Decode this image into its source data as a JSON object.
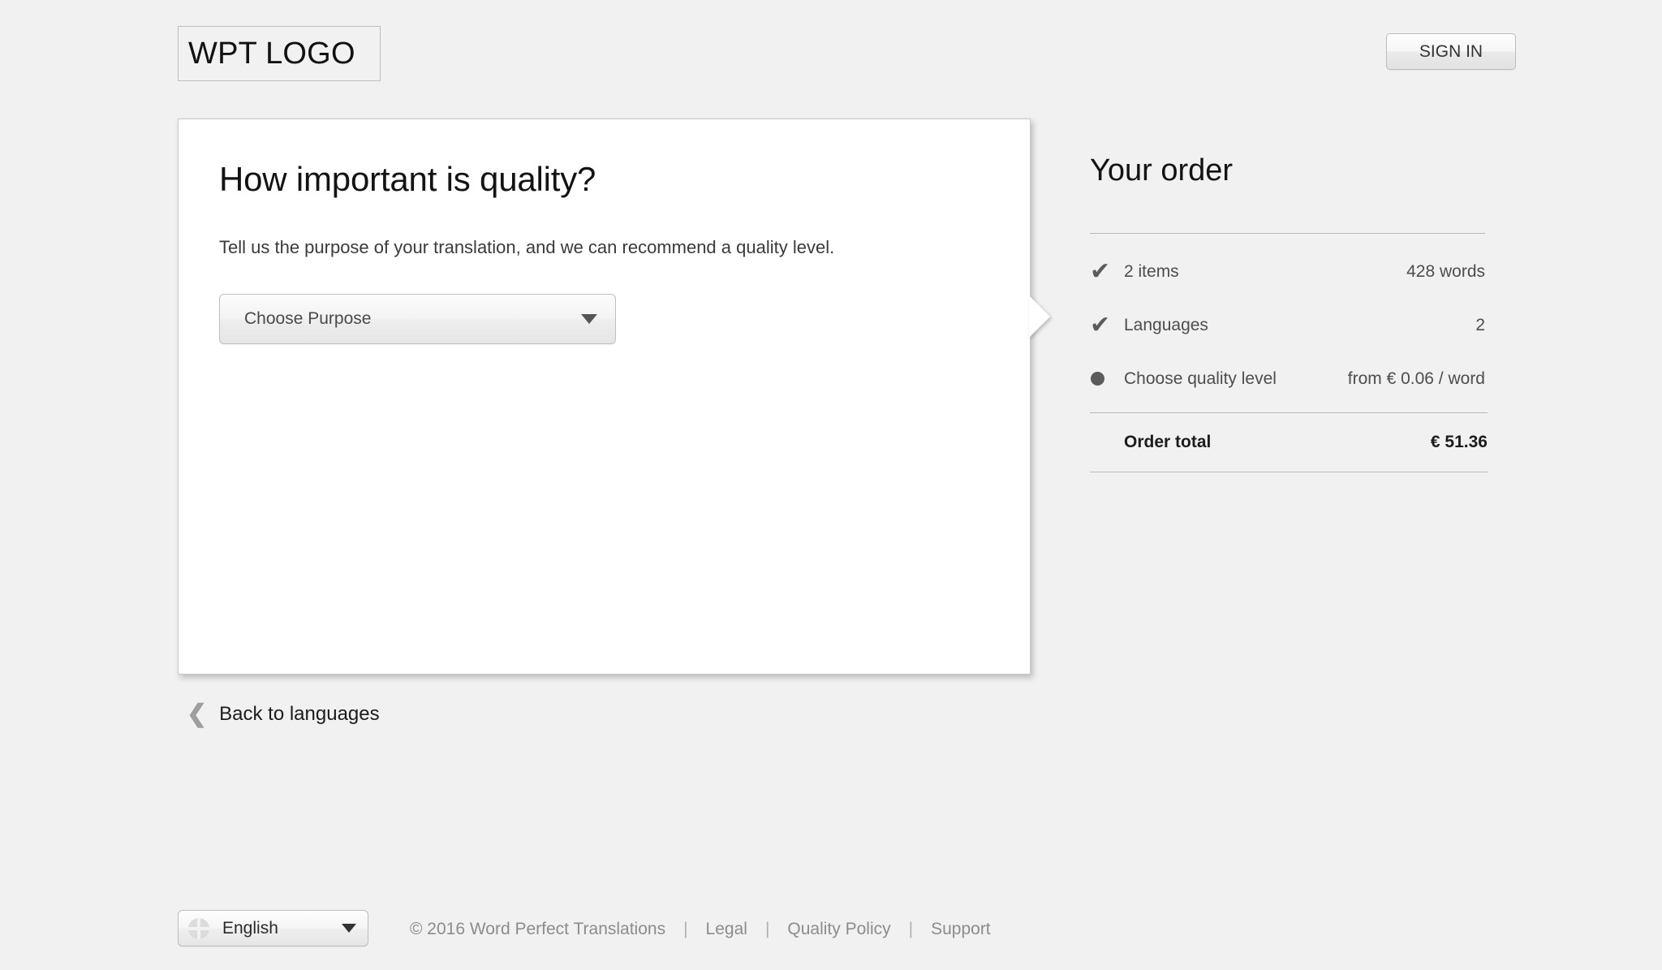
{
  "header": {
    "logo_text": "WPT LOGO",
    "signin_label": "SIGN IN"
  },
  "card": {
    "title": "How important is quality?",
    "subtitle": "Tell us the purpose of your translation, and we can recommend a quality level.",
    "purpose_select": {
      "value": "Choose Purpose",
      "caret": "chevron-down-icon"
    }
  },
  "back_link": {
    "chevron": "❮",
    "label": "Back to languages"
  },
  "order": {
    "title": "Your order",
    "rows": [
      {
        "marker": "check",
        "label": "2 items",
        "value": "428 words"
      },
      {
        "marker": "check",
        "label": "Languages",
        "value": "2"
      },
      {
        "marker": "dot",
        "label": "Choose quality level",
        "value": "from € 0.06 / word"
      }
    ],
    "check_glyph": "✔",
    "total_label": "Order total",
    "total_value": "€ 51.36"
  },
  "footer": {
    "language": {
      "icon": "globe-icon",
      "label": "English"
    },
    "copyright": "© 2016 Word Perfect Translations",
    "separator": "|",
    "links": [
      {
        "label": "Legal"
      },
      {
        "label": "Quality Policy"
      },
      {
        "label": "Support"
      }
    ]
  },
  "colors": {
    "page_background": "#f1f1f1",
    "card_background": "#ffffff",
    "text_primary": "#131313",
    "text_secondary": "#4d4d4d",
    "muted": "#8c8c8c",
    "rule": "#b9b9b9"
  }
}
